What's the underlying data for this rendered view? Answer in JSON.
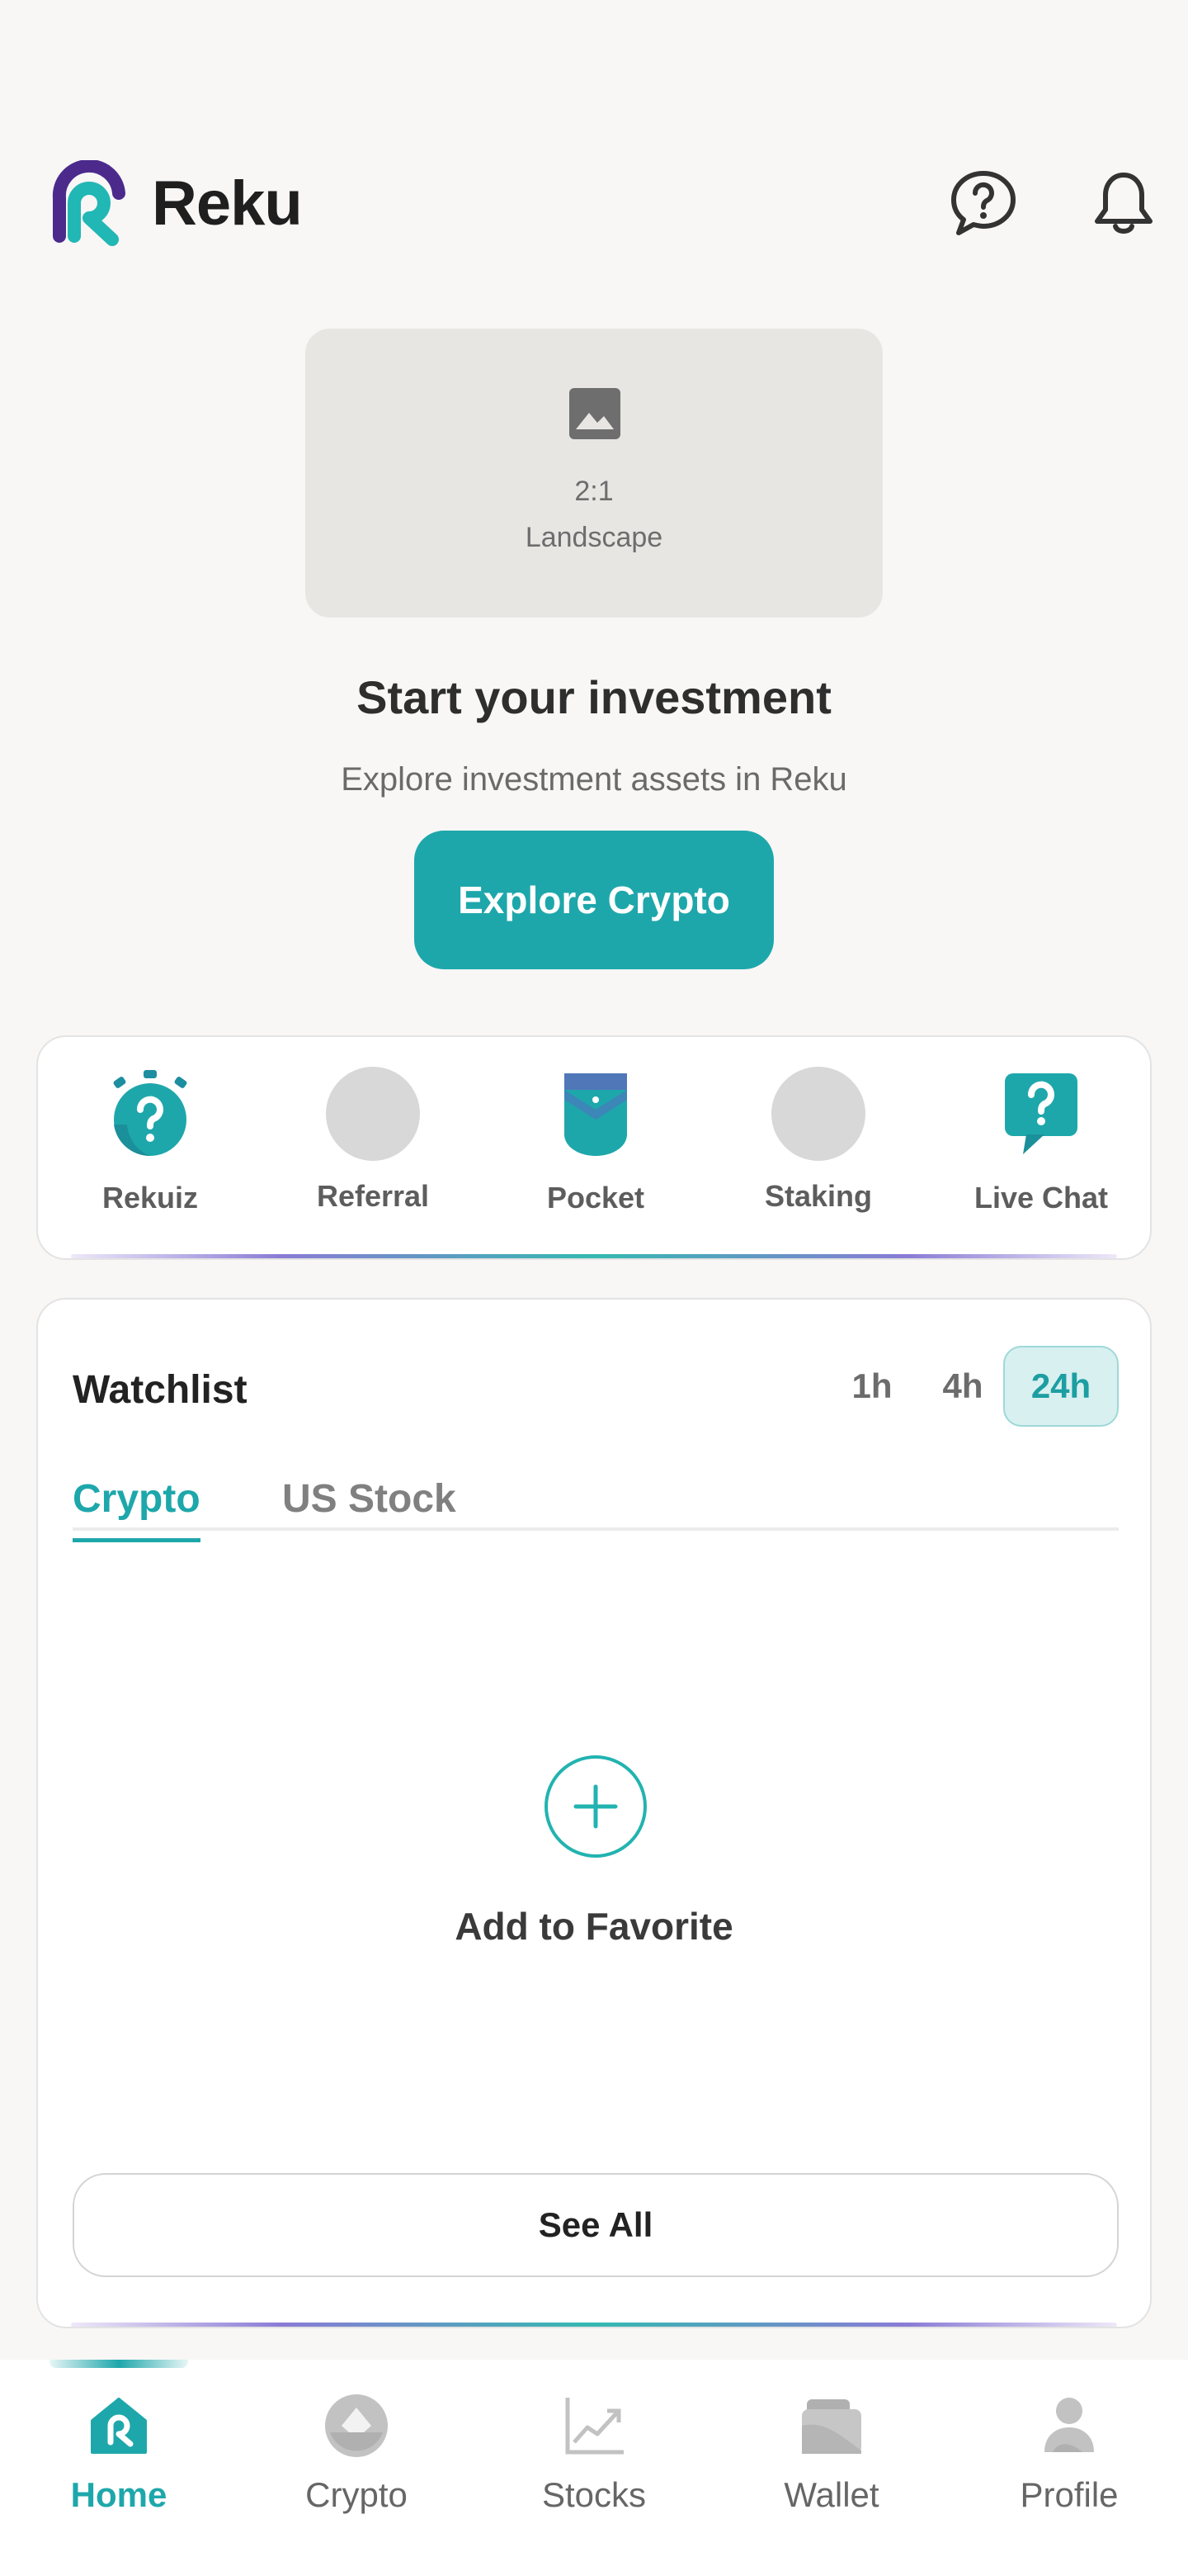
{
  "app": {
    "name": "Reku"
  },
  "header": {
    "help_icon": "help-chat-icon",
    "notification_icon": "bell-icon"
  },
  "banner": {
    "ratio": "2:1",
    "orientation": "Landscape",
    "icon": "image-icon"
  },
  "cta": {
    "title": "Start your investment",
    "subtitle": "Explore investment assets in Reku",
    "button_label": "Explore Crypto"
  },
  "shortcuts": [
    {
      "label": "Rekuiz",
      "icon": "quiz-timer-icon"
    },
    {
      "label": "Referral",
      "icon": "placeholder"
    },
    {
      "label": "Pocket",
      "icon": "pocket-icon"
    },
    {
      "label": "Staking",
      "icon": "placeholder"
    },
    {
      "label": "Live Chat",
      "icon": "live-chat-icon"
    }
  ],
  "watchlist": {
    "title": "Watchlist",
    "timeframes": [
      "1h",
      "4h",
      "24h"
    ],
    "selected_timeframe": "24h",
    "tabs": [
      "Crypto",
      "US Stock"
    ],
    "active_tab": "Crypto",
    "empty_action": "Add to Favorite",
    "see_all": "See All"
  },
  "bottom_nav": {
    "items": [
      {
        "label": "Home",
        "icon": "home-icon"
      },
      {
        "label": "Crypto",
        "icon": "crypto-icon"
      },
      {
        "label": "Stocks",
        "icon": "stocks-chart-icon"
      },
      {
        "label": "Wallet",
        "icon": "wallet-icon"
      },
      {
        "label": "Profile",
        "icon": "profile-icon"
      }
    ],
    "active": "Home"
  },
  "colors": {
    "accent": "#1ea7ab",
    "logo_purple": "#4b2a8c",
    "background": "#f8f7f6"
  }
}
